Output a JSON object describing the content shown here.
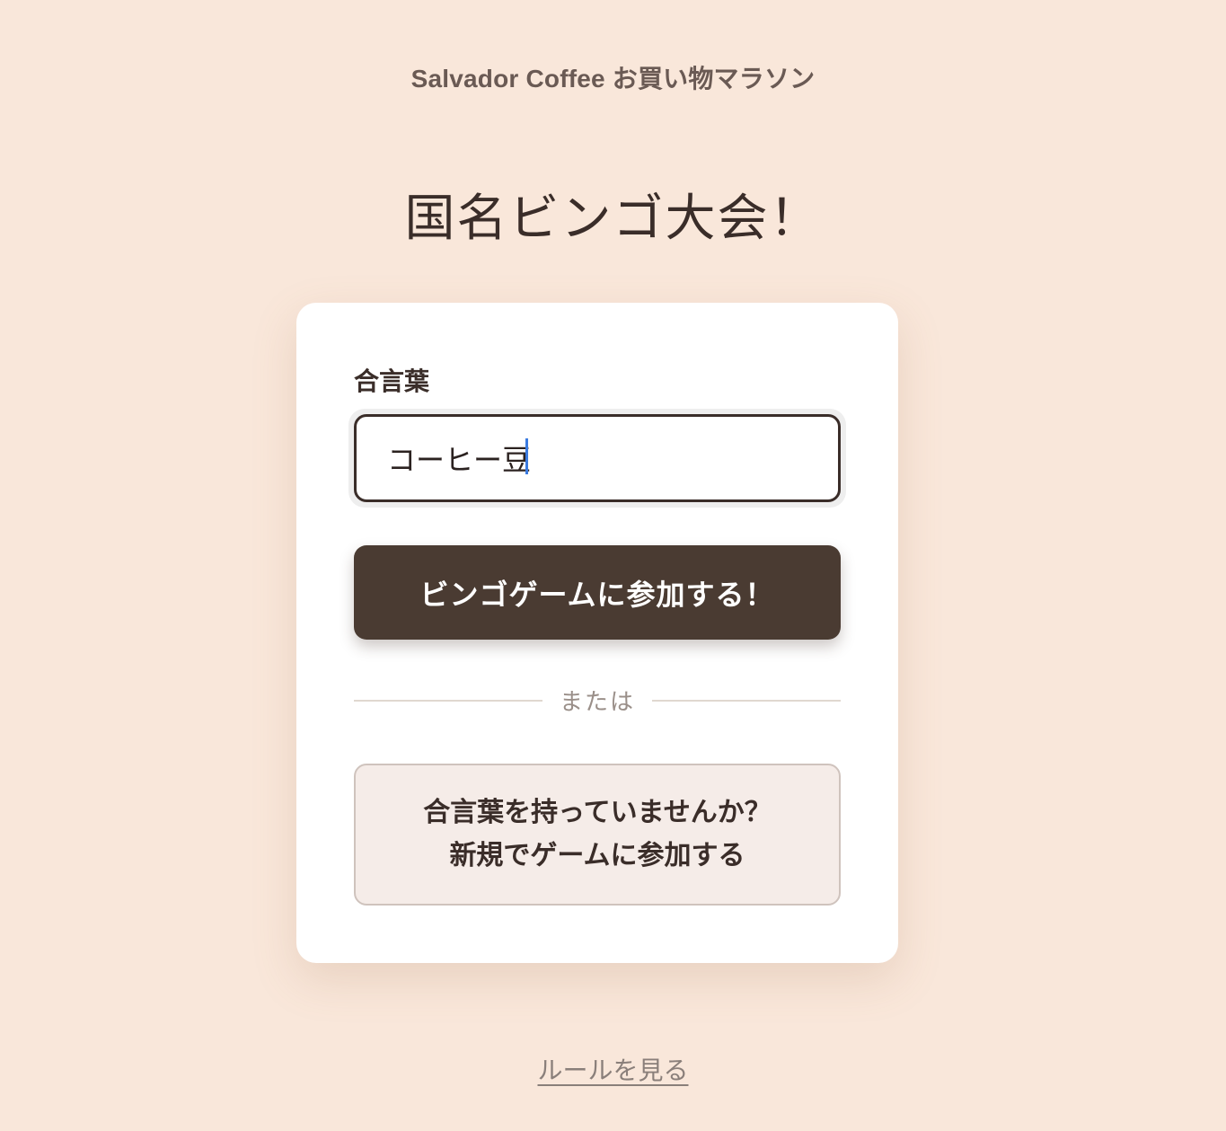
{
  "header": {
    "subtitle": "Salvador Coffee お買い物マラソン",
    "title": "国名ビンゴ大会！"
  },
  "form": {
    "label": "合言葉",
    "input_value": "コーヒー豆",
    "join_button": "ビンゴゲームに参加する！",
    "divider_text": "または",
    "new_game_line1": "合言葉を持っていませんか？",
    "new_game_line2": "新規でゲームに参加する"
  },
  "footer": {
    "rules_link": "ルールを見る"
  },
  "colors": {
    "background": "#f9e7da",
    "primary_button": "#4a3b32",
    "secondary_button": "#f5ece8",
    "caret": "#3b7be0"
  }
}
